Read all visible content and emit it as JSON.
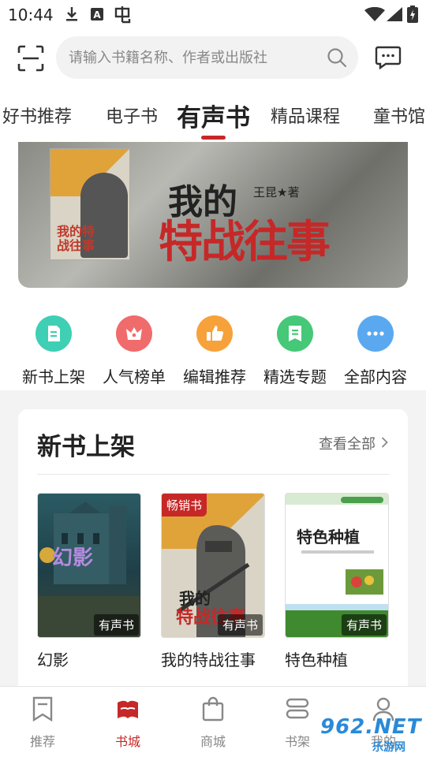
{
  "status_bar": {
    "time": "10:44"
  },
  "search": {
    "placeholder": "请输入书籍名称、作者或出版社"
  },
  "tabs": [
    {
      "label": "好书推荐"
    },
    {
      "label": "电子书"
    },
    {
      "label": "有声书",
      "active": true
    },
    {
      "label": "精品课程"
    },
    {
      "label": "童书馆"
    }
  ],
  "banner": {
    "book_title_line1": "我的",
    "book_title_line2": "特战往事",
    "author": "王昆★著",
    "cover_title": "我的特战往事"
  },
  "quick_links": [
    {
      "label": "新书上架",
      "icon": "new-book-icon",
      "color": "#3fcfb4"
    },
    {
      "label": "人气榜单",
      "icon": "crown-icon",
      "color": "#f06b6b"
    },
    {
      "label": "编辑推荐",
      "icon": "thumbs-up-icon",
      "color": "#f7a13a"
    },
    {
      "label": "精选专题",
      "icon": "bookmark-icon",
      "color": "#45c877"
    },
    {
      "label": "全部内容",
      "icon": "more-icon",
      "color": "#5aa9f0"
    }
  ],
  "section": {
    "title": "新书上架",
    "view_all": "查看全部",
    "books": [
      {
        "title": "幻影",
        "tag": "有声书",
        "cover_text": "幻影"
      },
      {
        "title": "我的特战往事",
        "tag": "有声书",
        "badge": "畅销书",
        "cover_text": "我的特战往事"
      },
      {
        "title": "特色种植",
        "tag": "有声书",
        "cover_text": "特色种植"
      }
    ]
  },
  "bottom_nav": [
    {
      "label": "推荐",
      "icon": "recommend-icon"
    },
    {
      "label": "书城",
      "icon": "bookstore-icon",
      "active": true
    },
    {
      "label": "商城",
      "icon": "shopping-bag-icon"
    },
    {
      "label": "书架",
      "icon": "bookshelf-icon"
    },
    {
      "label": "我的",
      "icon": "profile-icon"
    }
  ],
  "watermark": {
    "text": "962.NET",
    "sub": "乐游网"
  },
  "colors": {
    "accent": "#c62828",
    "bg": "#f3f3f3"
  }
}
